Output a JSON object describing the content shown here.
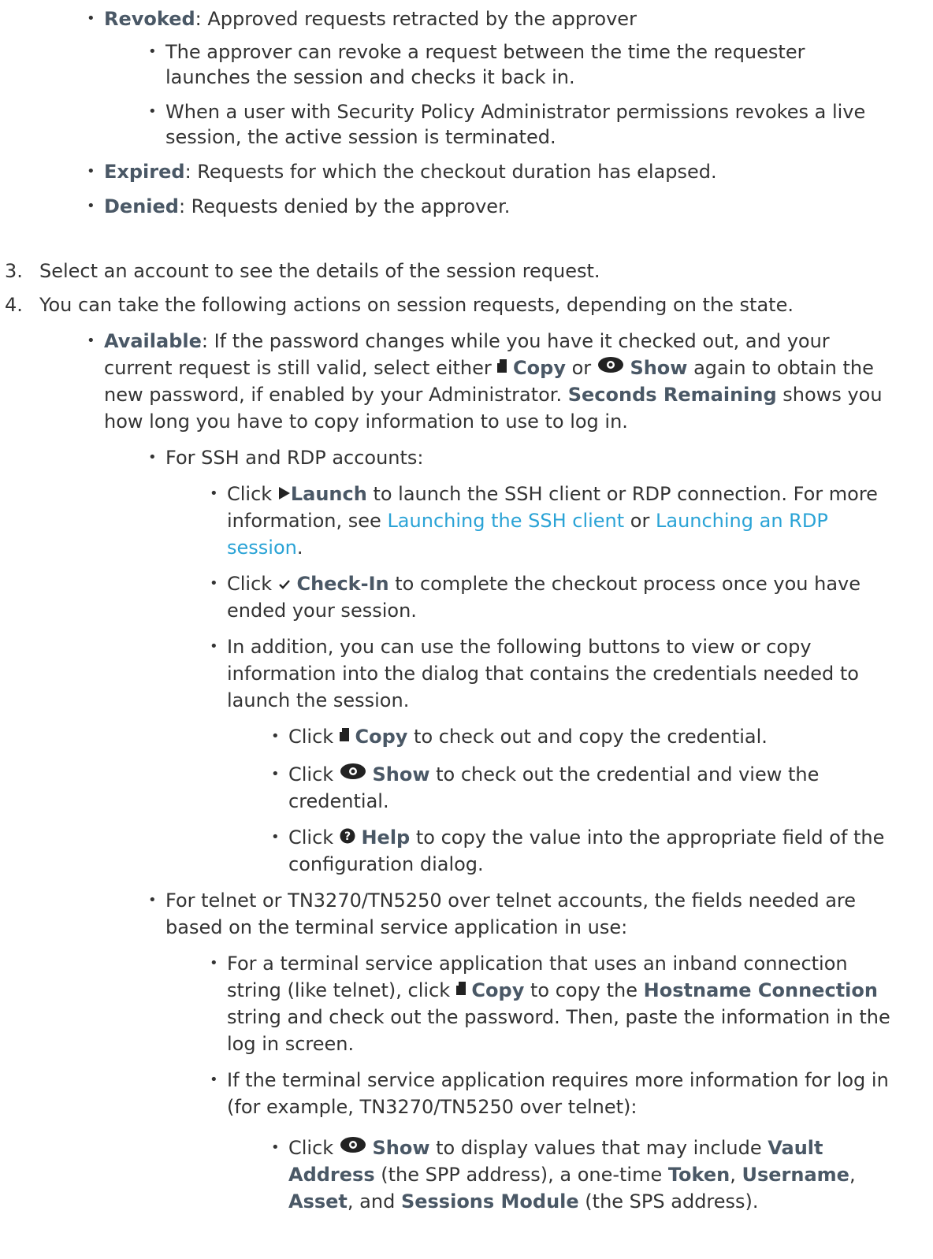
{
  "revoked": {
    "term": "Revoked",
    "text": ": Approved requests retracted by the approver"
  },
  "revoked_sub": [
    "The approver can revoke a request between the time the requester launches the session and checks it back in.",
    "When a user with Security Policy Administrator permissions revokes a live session, the active session is terminated."
  ],
  "expired": {
    "term": "Expired",
    "text": ": Requests for which the checkout duration has elapsed."
  },
  "denied": {
    "term": "Denied",
    "text": ": Requests denied by the approver."
  },
  "step3": {
    "num": "3.",
    "text": "Select an account to see the details of the session request."
  },
  "step4": {
    "num": "4.",
    "text": "You can take the following actions on session requests, depending on the state."
  },
  "available": {
    "term": "Available",
    "t1": ": If the password changes while you have it checked out, and your current request is still valid, select either ",
    "copy": "Copy",
    "or": " or ",
    "show": "Show",
    "t2": " again to obtain the new password, if enabled by your Administrator. ",
    "seconds": "Seconds Remaining",
    "t3": " shows you how long you have to copy information to use to log in."
  },
  "ssh_rdp": "For SSH and RDP accounts:",
  "launch": {
    "click": "Click ",
    "btn": "Launch",
    "t1": " to launch the SSH client or RDP connection. For more information, see ",
    "link1": "Launching the SSH client",
    "or": " or ",
    "link2": "Launching an RDP session",
    "end": "."
  },
  "checkin": {
    "click": "Click ",
    "btn": "Check-In",
    "t1": " to complete the checkout process once you have ended your session."
  },
  "addition": "In addition, you can use the following buttons to view or copy information into the dialog that contains the credentials needed to launch the session.",
  "copy_item": {
    "click": "Click ",
    "btn": "Copy",
    "t1": " to check out and copy the credential."
  },
  "show_item": {
    "click": "Click ",
    "btn": "Show",
    "t1": " to check out the credential and view the credential."
  },
  "help_item": {
    "click": "Click ",
    "btn": "Help",
    "t1": " to copy the value into the appropriate field of the configuration dialog."
  },
  "telnet": "For telnet or TN3270/TN5250 over telnet accounts, the fields needed are based on the terminal service application in use:",
  "inband": {
    "t1": "For a terminal service application that uses an inband connection string (like telnet), click ",
    "btn": "Copy",
    "t2": " to copy the ",
    "hostname": "Hostname Connection",
    "t3": " string and check out the password. Then, paste the information in the log in screen."
  },
  "more_info": "If the terminal service application requires more information for log in (for example, TN3270/TN5250 over telnet):",
  "show_values": {
    "click": "Click ",
    "btn": "Show",
    "t1": " to display values that may include ",
    "vault": "Vault Address",
    "t2": " (the SPP address), a one-time ",
    "token": "Token",
    "c1": ", ",
    "username": "Username",
    "c2": ", ",
    "asset": "Asset",
    "t3": ", and ",
    "sessions": "Sessions Module",
    "t4": " (the SPS address)."
  }
}
